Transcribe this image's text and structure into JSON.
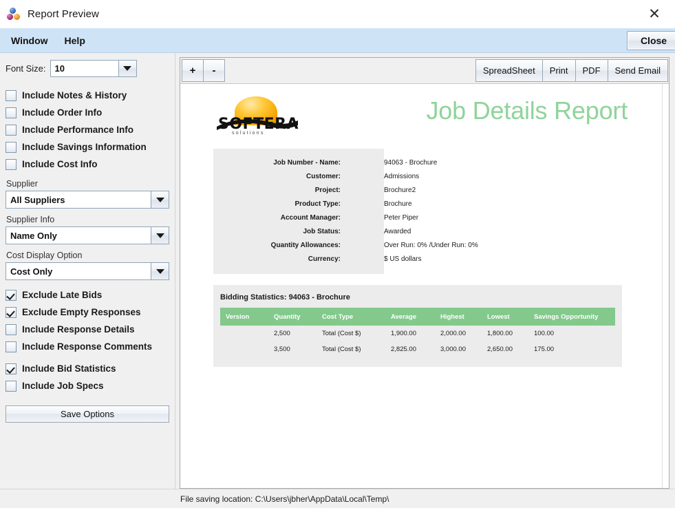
{
  "window": {
    "title": "Report Preview",
    "icon": "three-spheres-icon",
    "close_glyph": "✕"
  },
  "menubar": {
    "items": [
      {
        "label": "Window"
      },
      {
        "label": "Help"
      }
    ],
    "close_button": "Close"
  },
  "sidebar": {
    "font_size": {
      "label": "Font Size:",
      "value": "10"
    },
    "top_checkboxes": [
      {
        "label": "Include Notes & History",
        "checked": false
      },
      {
        "label": "Include Order Info",
        "checked": false
      },
      {
        "label": "Include Performance Info",
        "checked": false
      },
      {
        "label": "Include Savings Information",
        "checked": false
      },
      {
        "label": "Include Cost Info",
        "checked": false
      }
    ],
    "selects": [
      {
        "label": "Supplier",
        "value": "All Suppliers"
      },
      {
        "label": "Supplier Info",
        "value": "Name Only"
      },
      {
        "label": "Cost Display Option",
        "value": "Cost Only"
      }
    ],
    "bottom_checkboxes": [
      {
        "label": "Exclude Late Bids",
        "checked": true
      },
      {
        "label": "Exclude Empty Responses",
        "checked": true
      },
      {
        "label": "Include Response Details",
        "checked": false
      },
      {
        "label": "Include Response Comments",
        "checked": false
      }
    ],
    "bottom_checkboxes2": [
      {
        "label": "Include Bid Statistics",
        "checked": true
      },
      {
        "label": "Include Job Specs",
        "checked": false
      }
    ],
    "save_button": "Save Options"
  },
  "toolbar": {
    "zoom_in": "+",
    "zoom_out": "-",
    "actions": [
      {
        "label": "SpreadSheet"
      },
      {
        "label": "Print"
      },
      {
        "label": "PDF"
      },
      {
        "label": "Send Email"
      }
    ]
  },
  "report": {
    "logo": {
      "brand": "SOFTERA",
      "tagline": "solutions",
      "sun_color": "#ffc634"
    },
    "title": "Job Details Report",
    "title_color": "#8fd49a",
    "details": [
      {
        "key": "Job Number - Name:",
        "value": "94063 - Brochure"
      },
      {
        "key": "Customer:",
        "value": "Admissions"
      },
      {
        "key": "Project:",
        "value": "Brochure2"
      },
      {
        "key": "Product Type:",
        "value": "Brochure"
      },
      {
        "key": "Account Manager:",
        "value": "Peter Piper"
      },
      {
        "key": "Job Status:",
        "value": "Awarded"
      },
      {
        "key": "Quantity Allowances:",
        "value": "Over Run: 0% /Under Run: 0%"
      },
      {
        "key": "Currency:",
        "value": "$ US dollars"
      }
    ],
    "stats": {
      "title": "Bidding Statistics: 94063 - Brochure",
      "header_color": "#83c98c",
      "columns": [
        "Version",
        "Quantity",
        "Cost Type",
        "Average",
        "Highest",
        "Lowest",
        "Savings Opportunity"
      ],
      "rows": [
        [
          "",
          "2,500",
          "Total (Cost $)",
          "1,900.00",
          "2,000.00",
          "1,800.00",
          "100.00"
        ],
        [
          "",
          "3,500",
          "Total (Cost $)",
          "2,825.00",
          "3,000.00",
          "2,650.00",
          "175.00"
        ]
      ]
    }
  },
  "statusbar": {
    "text": "File saving location: C:\\Users\\jbher\\AppData\\Local\\Temp\\"
  }
}
